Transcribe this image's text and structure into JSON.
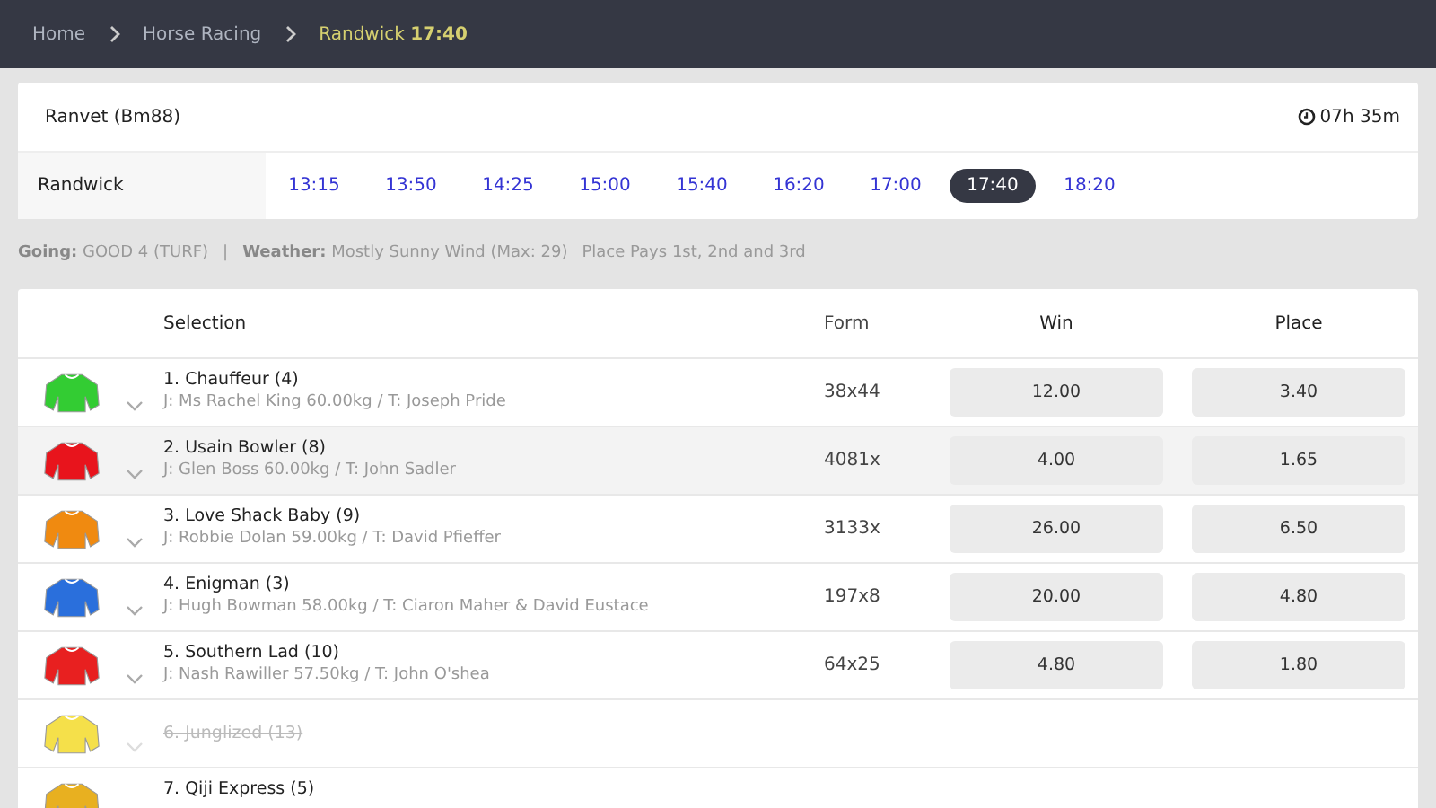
{
  "breadcrumb": [
    {
      "label": "Home",
      "current": false
    },
    {
      "label": "Horse Racing",
      "current": false
    },
    {
      "label": "Randwick **17:40**",
      "current": true
    }
  ],
  "race": {
    "name": "Ranvet (Bm88)",
    "countdown": "07h 35m",
    "venue": "Randwick",
    "times": [
      {
        "label": "13:15",
        "selected": false
      },
      {
        "label": "13:50",
        "selected": false
      },
      {
        "label": "14:25",
        "selected": false
      },
      {
        "label": "15:00",
        "selected": false
      },
      {
        "label": "15:40",
        "selected": false
      },
      {
        "label": "16:20",
        "selected": false
      },
      {
        "label": "17:00",
        "selected": false
      },
      {
        "label": "17:40",
        "selected": true
      },
      {
        "label": "18:20",
        "selected": false
      }
    ]
  },
  "info": [
    {
      "kind": "pair",
      "label": "Going:",
      "value": "GOOD 4 (TURF)"
    },
    {
      "kind": "divider",
      "value": "|"
    },
    {
      "kind": "pair",
      "label": "Weather:",
      "value": "Mostly Sunny Wind (Max: 29)"
    },
    {
      "kind": "text",
      "value": "Place Pays 1st, 2nd and 3rd"
    }
  ],
  "table": {
    "columns": [
      "Selection",
      "Form",
      "Win",
      "Place"
    ],
    "rows": [
      {
        "name": "1. Chauffeur (4)",
        "details": "J: Ms Rachel King 60.00kg / T: Joseph Pride",
        "form": "38x44",
        "win": "12.00",
        "place": "3.40",
        "color": "#33cc33",
        "highlighted": false,
        "scratched": false
      },
      {
        "name": "2. Usain Bowler (8)",
        "details": "J: Glen Boss 60.00kg / T: John Sadler",
        "form": "4081x",
        "win": "4.00",
        "place": "1.65",
        "color": "#e8141c",
        "highlighted": true,
        "scratched": false
      },
      {
        "name": "3. Love Shack Baby (9)",
        "details": "J: Robbie Dolan 59.00kg / T: David Pfieffer",
        "form": "3133x",
        "win": "26.00",
        "place": "6.50",
        "color": "#f08a10",
        "highlighted": false,
        "scratched": false
      },
      {
        "name": "4. Enigman (3)",
        "details": "J: Hugh Bowman 58.00kg / T: Ciaron Maher & David Eustace",
        "form": "197x8",
        "win": "20.00",
        "place": "4.80",
        "color": "#2a6fdc",
        "highlighted": false,
        "scratched": false
      },
      {
        "name": "5. Southern Lad (10)",
        "details": "J: Nash Rawiller 57.50kg / T: John O'shea",
        "form": "64x25",
        "win": "4.80",
        "place": "1.80",
        "color": "#e82020",
        "highlighted": false,
        "scratched": false
      },
      {
        "name": "6. Junglized (13)",
        "color": "#f5e04a",
        "highlighted": false,
        "scratched": true
      },
      {
        "name": "7. Qiji Express (5)",
        "color": "#e8b020",
        "highlighted": false,
        "scratched": false
      }
    ]
  }
}
